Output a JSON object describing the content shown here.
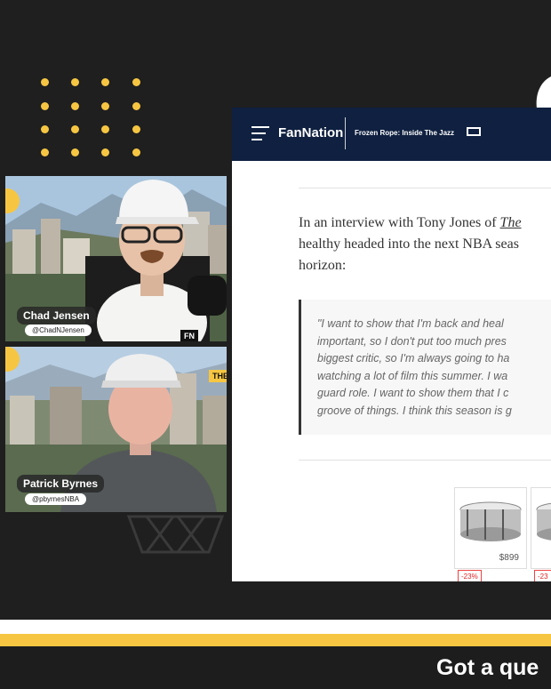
{
  "participants": [
    {
      "name": "Chad Jensen",
      "handle": "@ChadNJensen",
      "badge": "FN"
    },
    {
      "name": "Patrick Byrnes",
      "handle": "@pbyrnesNBA",
      "badge": "THE"
    }
  ],
  "article": {
    "brand": "FanNation",
    "publication": "Frozen Rope: Inside The Jazz",
    "intro_lines": [
      "In an interview with Tony Jones of ",
      "The",
      "healthy headed into the next NBA seas",
      "horizon:"
    ],
    "quote_lines": [
      "\"I want to show that I'm back and heal",
      "important, so I don't put too much pres",
      "biggest critic, so I'm always going to ha",
      "watching a lot of film this summer. I wa",
      "guard role. I want to show them that I c",
      "groove of things. I think this season is g"
    ],
    "ad": {
      "price": "$899",
      "discounts": [
        "-23%",
        "-23"
      ]
    }
  },
  "cta": {
    "text": "Got a que"
  },
  "colors": {
    "accent": "#f6c642",
    "header": "#0f2040",
    "background": "#1f1f1f"
  }
}
